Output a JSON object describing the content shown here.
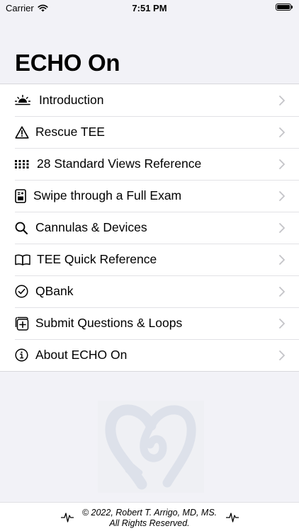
{
  "status_bar": {
    "carrier": "Carrier",
    "time": "7:51 PM"
  },
  "page_title": "ECHO On",
  "menu": {
    "items": [
      {
        "label": "Introduction",
        "icon": "sunrise-icon"
      },
      {
        "label": "Rescue TEE",
        "icon": "warning-triangle-icon"
      },
      {
        "label": "28 Standard Views Reference",
        "icon": "grid-icon"
      },
      {
        "label": "Swipe through a Full Exam",
        "icon": "document-image-icon"
      },
      {
        "label": "Cannulas & Devices",
        "icon": "magnifier-icon"
      },
      {
        "label": "TEE Quick Reference",
        "icon": "book-icon"
      },
      {
        "label": "QBank",
        "icon": "checkmark-circle-icon"
      },
      {
        "label": "Submit Questions & Loops",
        "icon": "plus-square-icon"
      },
      {
        "label": "About ECHO On",
        "icon": "info-circle-icon"
      }
    ]
  },
  "footer": {
    "copyright": "© 2022, Robert T. Arrigo, MD, MS.",
    "rights": "All Rights Reserved."
  },
  "colors": {
    "background": "#f2f2f7",
    "list_background": "#ffffff",
    "chevron": "#c4c4c8",
    "watermark": "#dde1ea"
  }
}
